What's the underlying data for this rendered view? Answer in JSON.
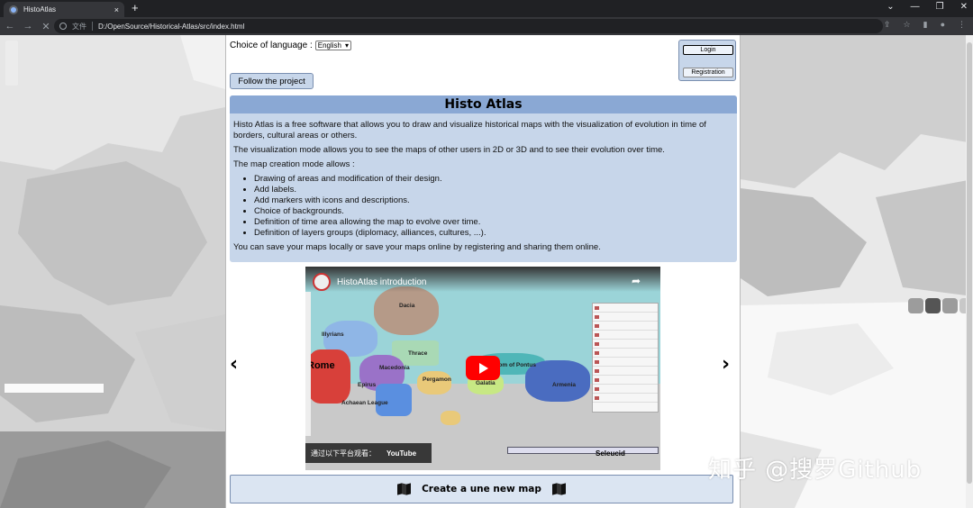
{
  "browser": {
    "tab_title": "HistoAtlas",
    "tab_close": "×",
    "new_tab": "+",
    "scheme_label": "文件",
    "url": "D:/OpenSource/Historical-Atlas/src/index.html"
  },
  "page": {
    "language_label": "Choice of language :",
    "language_selected": "English",
    "follow_label": "Follow the project",
    "login_label": "Login",
    "registration_label": "Registration",
    "title": "Histo Atlas",
    "intro": "Histo Atlas is a free software that allows you to draw and visualize historical maps with the visualization of evolution in time of borders, cultural areas or others.",
    "visualization_mode": "The visualization mode allows you to see the maps of other users in 2D or 3D and to see their evolution over time.",
    "creation_mode_intro": "The map creation mode allows :",
    "features": [
      "Drawing of areas and modification of their design.",
      "Add labels.",
      "Add markers with icons and descriptions.",
      "Choice of backgrounds.",
      "Definition of time area allowing the map to evolve over time.",
      "Definition of layers groups (diplomacy, alliances, cultures, ...)."
    ],
    "save_note": "You can save your maps locally or save your maps online by registering and sharing them online.",
    "create_label": "Create a une new map"
  },
  "video": {
    "title": "HistoAtlas introduction",
    "watch_on": "通过以下平台观看：",
    "youtube": "YouTube",
    "seleucid": "Seleucid",
    "regions": [
      "Dacia",
      "Illyrians",
      "Thrace",
      "Macedonia",
      "Rome",
      "Epirus",
      "Pergamon",
      "Galatia",
      "Kingdom of Pontus",
      "Armenia",
      "Achaean League"
    ]
  },
  "carousel": {
    "prev": "‹",
    "next": "›"
  },
  "watermark": "知乎 @搜罗Github"
}
